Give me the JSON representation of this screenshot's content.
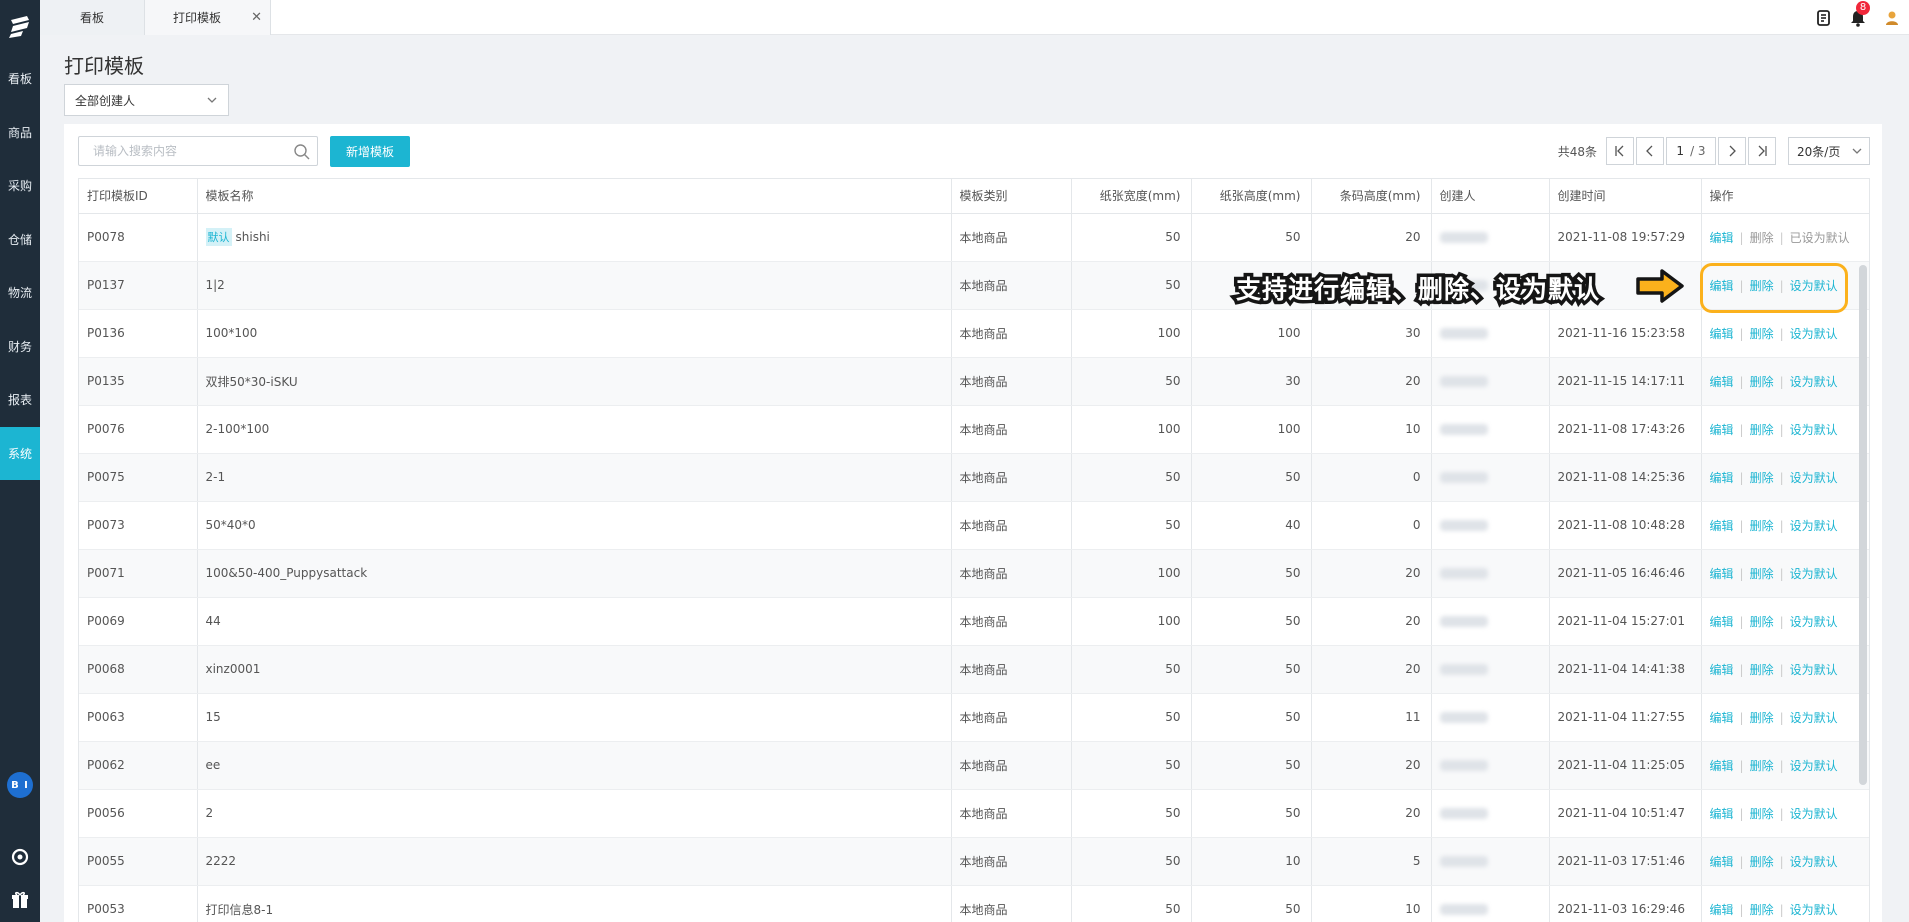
{
  "sidebar": {
    "items": [
      {
        "label": "看板"
      },
      {
        "label": "商品"
      },
      {
        "label": "采购"
      },
      {
        "label": "仓储"
      },
      {
        "label": "物流"
      },
      {
        "label": "财务"
      },
      {
        "label": "报表"
      },
      {
        "label": "系统"
      }
    ],
    "active_index": 7,
    "bi_label": "B I"
  },
  "tabs": [
    {
      "label": "看板"
    },
    {
      "label": "打印模板",
      "closable": true
    }
  ],
  "topbar": {
    "notification_count": "8"
  },
  "page": {
    "title": "打印模板",
    "creator_filter": "全部创建人"
  },
  "toolbar": {
    "search_placeholder": "请输入搜索内容",
    "add_label": "新增模板"
  },
  "pagination": {
    "total": "共48条",
    "current_page": "1",
    "total_pages": "/ 3",
    "page_size": "20条/页"
  },
  "table": {
    "columns": [
      "打印模板ID",
      "模板名称",
      "模板类别",
      "纸张宽度(mm)",
      "纸张高度(mm)",
      "条码高度(mm)",
      "创建人",
      "创建时间",
      "操作"
    ],
    "default_tag": "默认",
    "actions": {
      "edit": "编辑",
      "delete": "删除",
      "set_default": "设为默认",
      "already_default": "已设为默认"
    },
    "rows": [
      {
        "id": "P0078",
        "name": "shishi",
        "is_default": true,
        "category": "本地商品",
        "width": "50",
        "height": "50",
        "barcode": "20",
        "created": "2021-11-08 19:57:29"
      },
      {
        "id": "P0137",
        "name": "1|2",
        "is_default": false,
        "category": "本地商品",
        "width": "50",
        "height": "",
        "barcode": "",
        "created": ""
      },
      {
        "id": "P0136",
        "name": "100*100",
        "is_default": false,
        "category": "本地商品",
        "width": "100",
        "height": "100",
        "barcode": "30",
        "created": "2021-11-16 15:23:58"
      },
      {
        "id": "P0135",
        "name": "双排50*30-iSKU",
        "is_default": false,
        "category": "本地商品",
        "width": "50",
        "height": "30",
        "barcode": "20",
        "created": "2021-11-15 14:17:11"
      },
      {
        "id": "P0076",
        "name": "2-100*100",
        "is_default": false,
        "category": "本地商品",
        "width": "100",
        "height": "100",
        "barcode": "10",
        "created": "2021-11-08 17:43:26"
      },
      {
        "id": "P0075",
        "name": "2-1",
        "is_default": false,
        "category": "本地商品",
        "width": "50",
        "height": "50",
        "barcode": "0",
        "created": "2021-11-08 14:25:36"
      },
      {
        "id": "P0073",
        "name": "50*40*0",
        "is_default": false,
        "category": "本地商品",
        "width": "50",
        "height": "40",
        "barcode": "0",
        "created": "2021-11-08 10:48:28"
      },
      {
        "id": "P0071",
        "name": "100&50-400_Puppysattack",
        "is_default": false,
        "category": "本地商品",
        "width": "100",
        "height": "50",
        "barcode": "20",
        "created": "2021-11-05 16:46:46"
      },
      {
        "id": "P0069",
        "name": "44",
        "is_default": false,
        "category": "本地商品",
        "width": "100",
        "height": "50",
        "barcode": "20",
        "created": "2021-11-04 15:27:01"
      },
      {
        "id": "P0068",
        "name": "xinz0001",
        "is_default": false,
        "category": "本地商品",
        "width": "50",
        "height": "50",
        "barcode": "20",
        "created": "2021-11-04 14:41:38"
      },
      {
        "id": "P0063",
        "name": "15",
        "is_default": false,
        "category": "本地商品",
        "width": "50",
        "height": "50",
        "barcode": "11",
        "created": "2021-11-04 11:27:55"
      },
      {
        "id": "P0062",
        "name": "ee",
        "is_default": false,
        "category": "本地商品",
        "width": "50",
        "height": "50",
        "barcode": "20",
        "created": "2021-11-04 11:25:05"
      },
      {
        "id": "P0056",
        "name": "2",
        "is_default": false,
        "category": "本地商品",
        "width": "50",
        "height": "50",
        "barcode": "20",
        "created": "2021-11-04 10:51:47"
      },
      {
        "id": "P0055",
        "name": "2222",
        "is_default": false,
        "category": "本地商品",
        "width": "50",
        "height": "10",
        "barcode": "5",
        "created": "2021-11-03 17:51:46"
      },
      {
        "id": "P0053",
        "name": "打印信息8-1",
        "is_default": false,
        "category": "本地商品",
        "width": "50",
        "height": "50",
        "barcode": "10",
        "created": "2021-11-03 16:29:46"
      }
    ]
  },
  "annotation": {
    "text": "支持进行编辑、删除、设为默认",
    "ring_color": "#fbb11c"
  },
  "colors": {
    "accent": "#1cb5d2",
    "sidebar": "#1f2d3a",
    "badge": "#f0273a"
  }
}
